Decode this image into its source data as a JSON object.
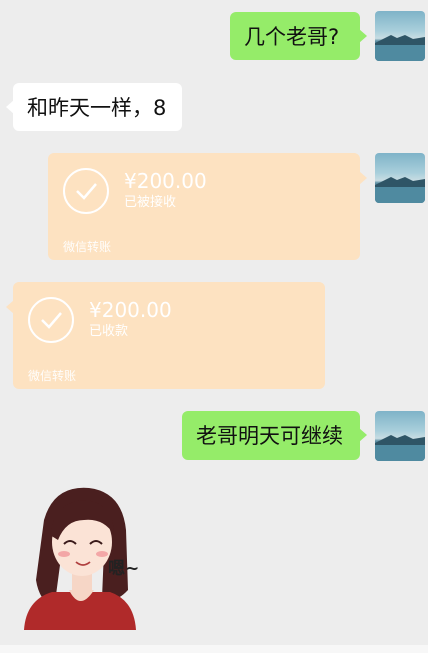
{
  "messages": {
    "m1": {
      "text": "几个老哥?"
    },
    "m2": {
      "text": "和昨天一样，8"
    },
    "m3": {
      "amount": "¥200.00",
      "status": "已被接收",
      "footer": "微信转账"
    },
    "m4": {
      "amount": "¥200.00",
      "status": "已收款",
      "footer": "微信转账"
    },
    "m5": {
      "text": "老哥明天可继续"
    },
    "sticker": {
      "caption": "嗯~"
    }
  },
  "colors": {
    "background": "#ededed",
    "sent_bubble": "#95ec69",
    "received_bubble": "#ffffff",
    "transfer_bubble": "#fde2c1"
  },
  "icons": {
    "avatar": "lake-landscape-avatar",
    "transfer": "check-circle-icon"
  }
}
